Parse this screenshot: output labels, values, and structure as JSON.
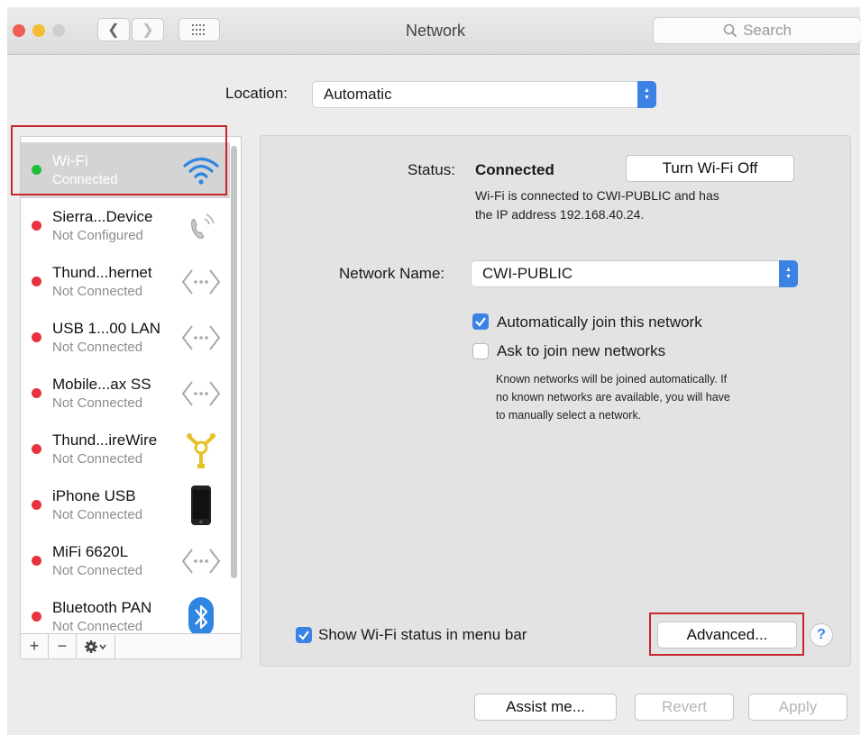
{
  "window": {
    "title": "Network",
    "search_placeholder": "Search",
    "grid_icon": "grid-icon"
  },
  "location": {
    "label": "Location:",
    "value": "Automatic"
  },
  "services": [
    {
      "name": "Wi-Fi",
      "status": "Connected",
      "dot": "green",
      "icon": "wifi-icon",
      "selected": true
    },
    {
      "name": "Sierra...Device",
      "status": "Not Configured",
      "dot": "red",
      "icon": "phone-modem-icon"
    },
    {
      "name": "Thund...hernet",
      "status": "Not Connected",
      "dot": "red",
      "icon": "ethernet-icon"
    },
    {
      "name": "USB 1...00 LAN",
      "status": "Not Connected",
      "dot": "red",
      "icon": "ethernet-icon"
    },
    {
      "name": "Mobile...ax SS",
      "status": "Not Connected",
      "dot": "red",
      "icon": "ethernet-icon"
    },
    {
      "name": "Thund...ireWire",
      "status": "Not Connected",
      "dot": "red",
      "icon": "firewire-icon"
    },
    {
      "name": "iPhone USB",
      "status": "Not Connected",
      "dot": "red",
      "icon": "iphone-icon"
    },
    {
      "name": "MiFi 6620L",
      "status": "Not Connected",
      "dot": "red",
      "icon": "ethernet-icon"
    },
    {
      "name": "Bluetooth PAN",
      "status": "Not Connected",
      "dot": "red",
      "icon": "bluetooth-icon"
    }
  ],
  "list_toolbar": {
    "add": "+",
    "remove": "−",
    "gear_icon": "gear-icon"
  },
  "detail": {
    "status_label": "Status:",
    "status_value": "Connected",
    "turn_off_button": "Turn Wi-Fi Off",
    "status_desc_line1": "Wi-Fi is connected to CWI-PUBLIC and has",
    "status_desc_line2": "the IP address 192.168.40.24.",
    "network_name_label": "Network Name:",
    "network_name_value": "CWI-PUBLIC",
    "auto_join_label": "Automatically join this network",
    "auto_join_checked": true,
    "ask_join_label": "Ask to join new networks",
    "ask_join_checked": false,
    "known_line1": "Known networks will be joined automatically. If",
    "known_line2": "no known networks are available, you will have",
    "known_line3": "to manually select a network.",
    "show_status_label": "Show Wi-Fi status in menu bar",
    "show_status_checked": true,
    "advanced_button": "Advanced...",
    "help": "?"
  },
  "footer": {
    "assist": "Assist me...",
    "revert": "Revert",
    "apply": "Apply"
  },
  "colors": {
    "accent": "#3b82e4",
    "highlight": "#c8272c",
    "connected": "#1fbf3a",
    "disconnected": "#e8333f"
  }
}
